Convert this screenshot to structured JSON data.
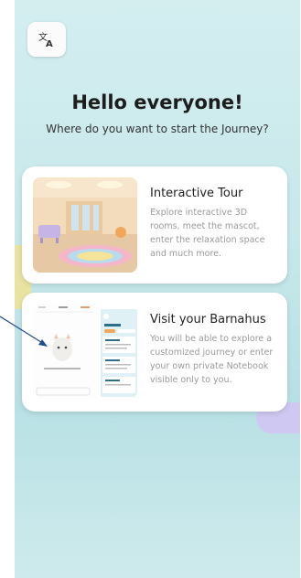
{
  "language_button": {
    "icon": "translate-icon"
  },
  "header": {
    "title": "Hello everyone!",
    "subtitle": "Where do you want to start the Journey?"
  },
  "cards": [
    {
      "title": "Interactive Tour",
      "description": "Explore interactive 3D rooms, meet the mascot, enter the relaxation space and much more.",
      "image": "3d-room-illustration"
    },
    {
      "title": "Visit your Barnahus",
      "description": "You will be able to explore a customized journey or enter your own private Notebook visible only to you.",
      "image": "app-screens-preview"
    }
  ],
  "colors": {
    "background": "#c6e7ea",
    "card": "#ffffff",
    "title": "#1d1d1d",
    "description": "#9a9a9a",
    "accent_orange": "#f2a65a",
    "arrow": "#1e4d8c"
  }
}
